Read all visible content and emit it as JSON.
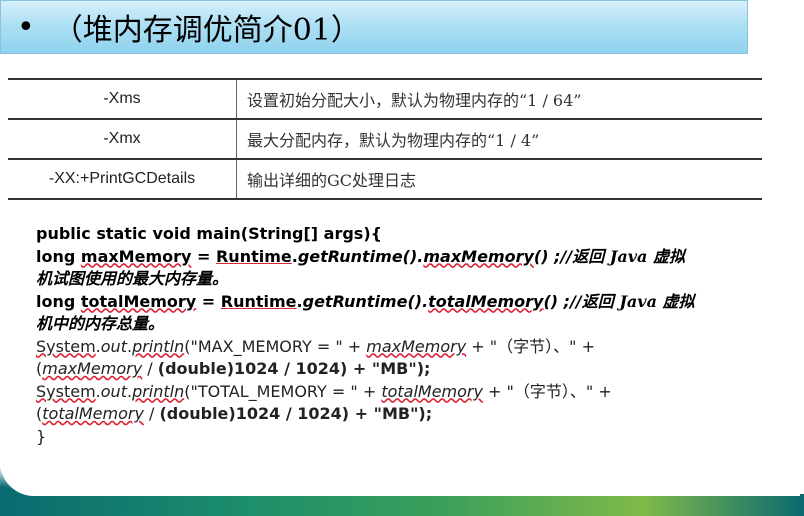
{
  "slide": {
    "bullet": "•",
    "title": "（堆内存调优简介01）"
  },
  "options_table": [
    {
      "flag": "-Xms",
      "desc": "设置初始分配大小，默认为物理内存的“1 / 64”"
    },
    {
      "flag": "-Xmx",
      "desc": "最大分配内存，默认为物理内存的“1 / 4”"
    },
    {
      "flag": "-XX:+PrintGCDetails",
      "desc": "输出详细的GC处理日志"
    }
  ],
  "code": {
    "l1": "public static void main(String[] args){",
    "l2a": "long ",
    "l2b": "maxMemory",
    "l2c": " = ",
    "l2d": "Runtime",
    "l2e": ".",
    "l2f": "getRuntime",
    "l2g": "()",
    "l2h": ".",
    "l2i": "maxMemory",
    "l2j": "() ;//",
    "l2k": "返回 Java 虚拟",
    "l3": "机试图使用的最大内存量。",
    "l4a": "long ",
    "l4b": "totalMemory",
    "l4c": " = ",
    "l4d": "Runtime",
    "l4e": ".",
    "l4f": "getRuntime",
    "l4g": "()",
    "l4h": ".",
    "l4i": "totalMemory",
    "l4j": "() ;//",
    "l4k": "返回 Java 虚拟",
    "l5": "机中的内存总量。",
    "l6a": "System",
    "l6b": ".",
    "l6c": "out",
    "l6d": ".",
    "l6e": "println",
    "l6f": "(\"MAX_MEMORY = \" + ",
    "l6g": "maxMemory",
    "l6h": " + \"（字节）、\" +",
    "l7a": "(",
    "l7b": "maxMemory",
    "l7c": " / ",
    "l7d": "(double)1024 / 1024) + \"MB\");",
    "l8a": "System",
    "l8b": ".",
    "l8c": "out",
    "l8d": ".",
    "l8e": "println",
    "l8f": "(\"TOTAL_MEMORY = \" + ",
    "l8g": "totalMemory",
    "l8h": " + \"（字节）、\" +",
    "l9a": "(",
    "l9b": "totalMemory",
    "l9c": " / ",
    "l9d": "(double)1024 / 1024) + \"MB\");",
    "l10": "}"
  }
}
